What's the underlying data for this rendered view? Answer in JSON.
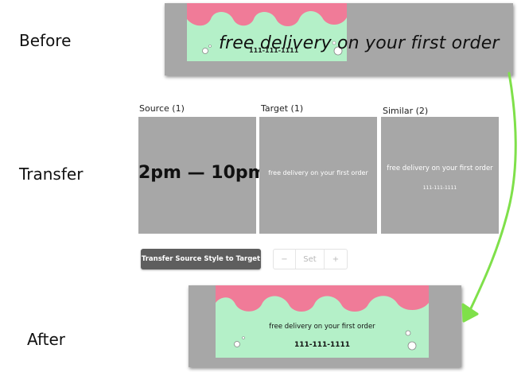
{
  "rows": {
    "before": "Before",
    "transfer": "Transfer",
    "after": "After"
  },
  "before_banner": {
    "headline": "free delivery on your first order",
    "small_text": "111-111-1111"
  },
  "panels": {
    "source": {
      "title": "Source (1)",
      "text": "2pm — 10pm"
    },
    "target": {
      "title": "Target (1)",
      "text": "free delivery on your first order"
    },
    "similar": {
      "title": "Similar (2)",
      "text1": "free delivery on your first order",
      "text2": "111-111-1111"
    }
  },
  "controls": {
    "transfer_button": "Transfer Source Style to Target",
    "stepper": {
      "minus": "−",
      "set": "Set",
      "plus": "+"
    }
  },
  "after_banner": {
    "line1": "free delivery on your first order",
    "line2": "111-111-1111"
  },
  "colors": {
    "banner_gray": "#a7a7a7",
    "card_green": "#b4f0c8",
    "card_pink": "#f07b98",
    "arrow_green": "#7fe04a",
    "button_dark": "#5e5e5e"
  },
  "icons": {
    "arrow": "curved-arrow-icon",
    "decor": "bubble-circle-icon"
  }
}
